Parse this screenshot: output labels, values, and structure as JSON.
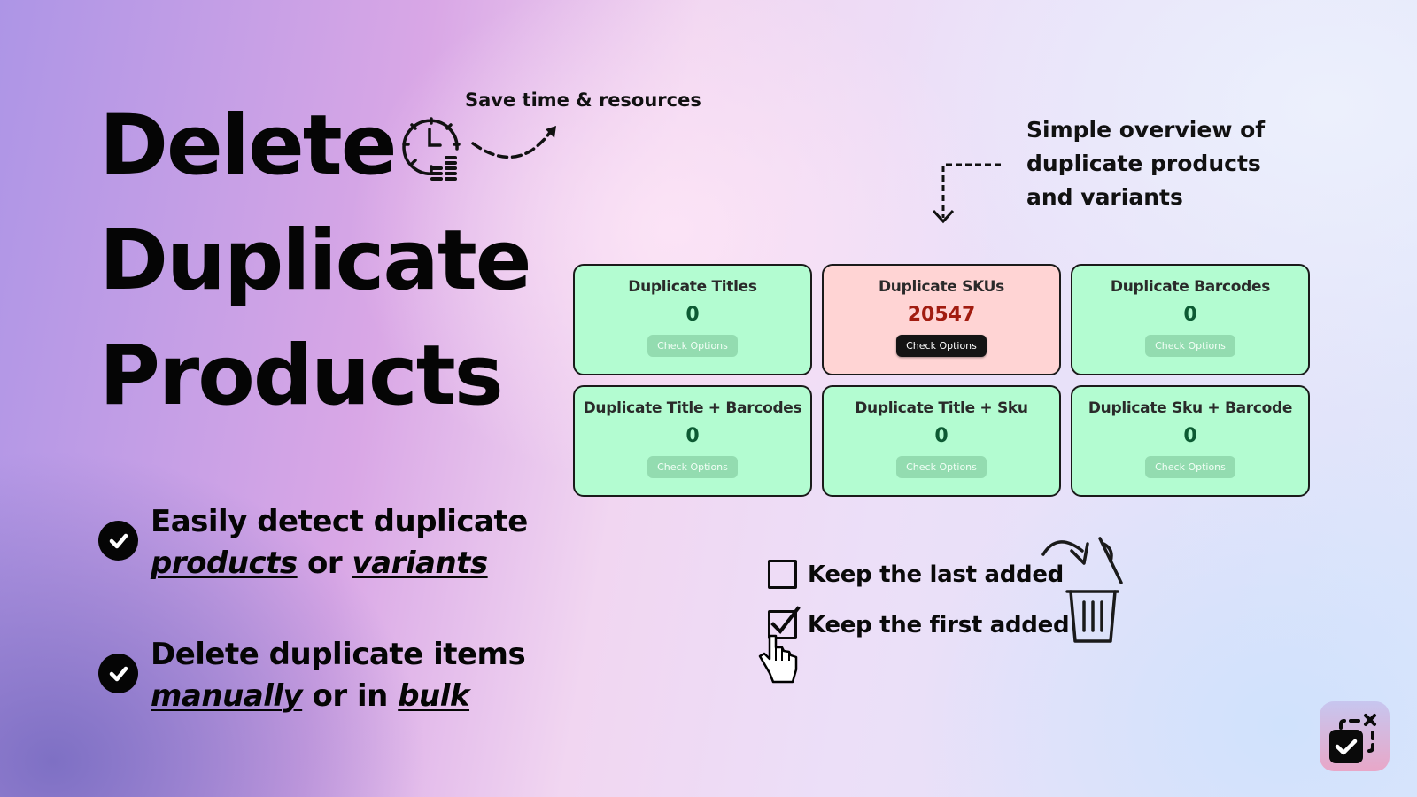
{
  "headline": {
    "lines": [
      "Delete",
      "Duplicate",
      "Products"
    ]
  },
  "annotations": {
    "save_time": "Save time & resources",
    "overview": [
      "Simple overview of",
      "duplicate products",
      "and variants"
    ]
  },
  "cards": [
    {
      "title": "Duplicate Titles",
      "count": "0",
      "button": "Check Options",
      "status": "ok"
    },
    {
      "title": "Duplicate SKUs",
      "count": "20547",
      "button": "Check Options",
      "status": "alert"
    },
    {
      "title": "Duplicate Barcodes",
      "count": "0",
      "button": "Check Options",
      "status": "ok"
    },
    {
      "title": "Duplicate Title + Barcodes",
      "count": "0",
      "button": "Check Options",
      "status": "ok"
    },
    {
      "title": "Duplicate Title + Sku",
      "count": "0",
      "button": "Check Options",
      "status": "ok"
    },
    {
      "title": "Duplicate Sku + Barcode",
      "count": "0",
      "button": "Check Options",
      "status": "ok"
    }
  ],
  "features": [
    {
      "line1": "Easily detect duplicate",
      "em1": "products",
      "mid": " or ",
      "em2": "variants"
    },
    {
      "line1": "Delete duplicate items",
      "em1": "manually",
      "mid": " or in ",
      "em2": "bulk"
    }
  ],
  "options": [
    {
      "label": "Keep the last added",
      "checked": false
    },
    {
      "label": "Keep the first added",
      "checked": true
    }
  ],
  "colors": {
    "card_ok_bg": "#b3fcd1",
    "card_alert_bg": "#ffd4d4",
    "count_ok": "#0d5a33",
    "count_alert": "#a11c10"
  },
  "icons": {
    "clock_coins": "clock-coins-icon",
    "curve_arrow": "dashed-curve-arrow-icon",
    "elbow_arrow": "dashed-elbow-arrow-icon",
    "check_circle": "check-circle-icon",
    "hand_cursor": "hand-pointer-icon",
    "trash": "trash-icon",
    "app_logo": "app-logo-icon"
  }
}
